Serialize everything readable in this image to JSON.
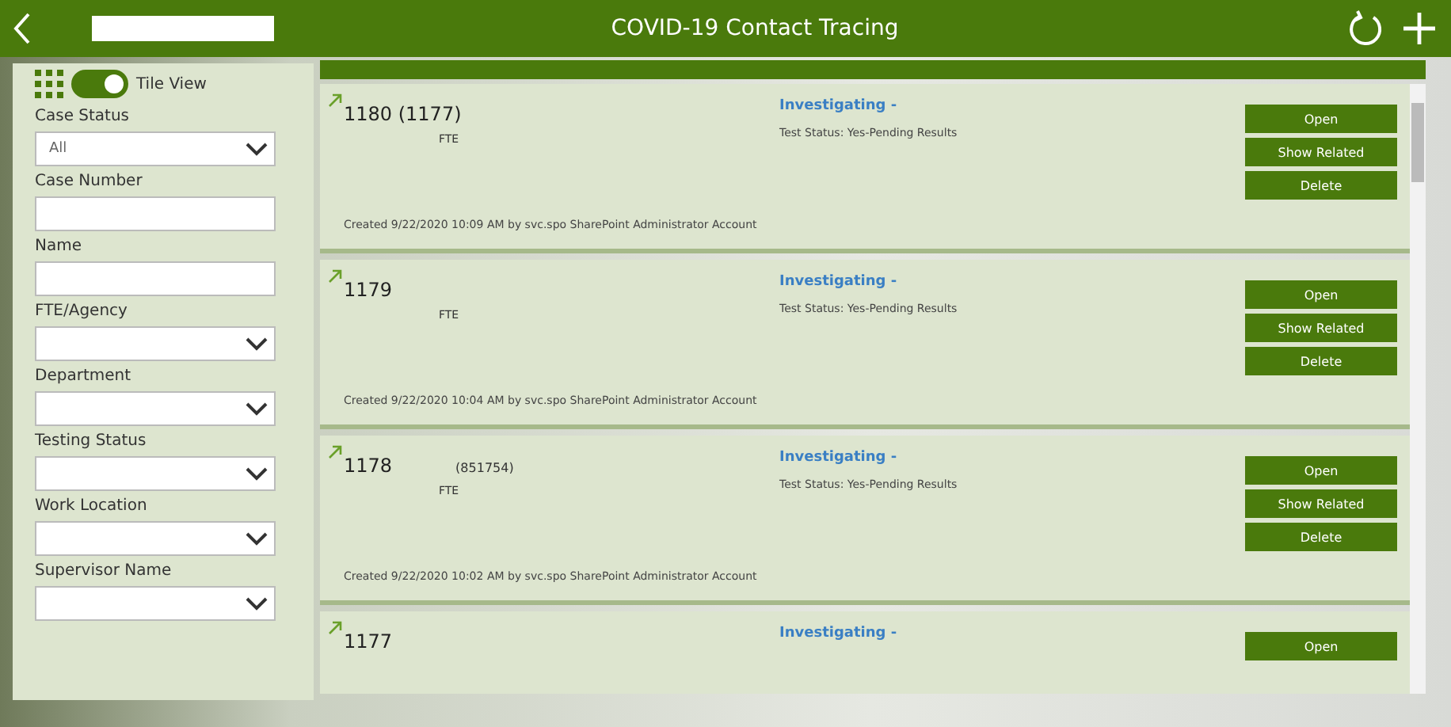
{
  "header": {
    "title": "COVID-19 Contact Tracing"
  },
  "filters": {
    "view_toggle": {
      "label": "Tile View",
      "on": true
    },
    "fields": [
      {
        "label": "Case Status",
        "kind": "dropdown",
        "value": "All"
      },
      {
        "label": "Case Number",
        "kind": "text"
      },
      {
        "label": "Name",
        "kind": "text"
      },
      {
        "label": "FTE/Agency",
        "kind": "dropdown"
      },
      {
        "label": "Department",
        "kind": "dropdown"
      },
      {
        "label": "Testing Status",
        "kind": "dropdown"
      },
      {
        "label": "Work Location",
        "kind": "dropdown"
      },
      {
        "label": "Supervisor Name",
        "kind": "dropdown"
      }
    ]
  },
  "cases": [
    {
      "number": "1180 (1177)",
      "type": "FTE",
      "status": "Investigating -",
      "test_status": "Test Status: Yes-Pending Results",
      "created": "Created 9/22/2020 10:09 AM by svc.spo SharePoint Administrator Account",
      "buttons": [
        "Open",
        "Show Related",
        "Delete"
      ]
    },
    {
      "number": "1179",
      "type": "FTE",
      "status": "Investigating -",
      "test_status": "Test Status: Yes-Pending Results",
      "created": "Created 9/22/2020 10:04 AM by svc.spo SharePoint Administrator Account",
      "buttons": [
        "Open",
        "Show Related",
        "Delete"
      ]
    },
    {
      "number": "1178",
      "employee_id": "(851754)",
      "type": "FTE",
      "status": "Investigating -",
      "test_status": "Test Status: Yes-Pending Results",
      "created": "Created 9/22/2020 10:02 AM by svc.spo SharePoint Administrator Account",
      "buttons": [
        "Open",
        "Show Related",
        "Delete"
      ]
    },
    {
      "number": "1177",
      "status": "Investigating -",
      "buttons": [
        "Open"
      ]
    }
  ]
}
